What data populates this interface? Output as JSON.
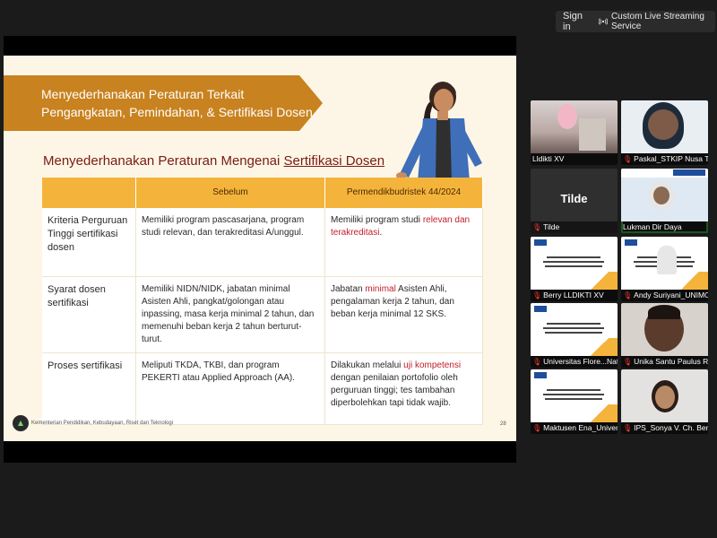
{
  "topbar": {
    "sign_in": "Sign in",
    "streaming": "Custom Live Streaming Service",
    "streaming_icon": "broadcast-icon"
  },
  "slide": {
    "banner_line1": "Menyederhanakan Peraturan Terkait",
    "banner_line2": "Pengangkatan, Pemindahan, & Sertifikasi Dosen",
    "heading_prefix": "Menyederhanakan Peraturan Mengenai ",
    "heading_underlined": "Sertifikasi Dosen",
    "table": {
      "col1": "",
      "col2": "Sebelum",
      "col3": "Permendikbudristek 44/2024",
      "rows": [
        {
          "key": "Kriteria Perguruan Tinggi sertifikasi dosen",
          "before": "Memiliki program pascasarjana, program studi relevan, dan terakreditasi A/unggul.",
          "after_pre": "Memiliki program studi ",
          "after_hl": "relevan dan terakreditasi",
          "after_post": "."
        },
        {
          "key": "Syarat dosen sertifikasi",
          "before": "Memiliki NIDN/NIDK, jabatan minimal Asisten Ahli, pangkat/golongan atau inpassing, masa kerja minimal 2 tahun, dan memenuhi beban kerja 2 tahun berturut-turut.",
          "after_pre": "Jabatan ",
          "after_hl": "minimal",
          "after_post": " Asisten Ahli, pengalaman kerja 2 tahun, dan beban kerja minimal 12 SKS."
        },
        {
          "key": "Proses sertifikasi",
          "before": "Meliputi TKDA, TKBI, dan program PEKERTI atau Applied Approach (AA).",
          "after_pre": "Dilakukan melalui ",
          "after_hl": "uji kompetensi",
          "after_post": " dengan penilaian portofolio oleh perguruan tinggi; tes tambahan diperbolehkan tapi tidak wajib."
        }
      ]
    },
    "footer": "Kementerian Pendidikan, Kebudayaan, Riset dan Teknologi",
    "page_number": "28"
  },
  "participants": [
    {
      "name": "Lldikti XV",
      "muted": false,
      "kind": "photo"
    },
    {
      "name": "Paskal_STKIP Nusa Tim...",
      "muted": true,
      "kind": "photo"
    },
    {
      "name": "Tilde",
      "muted": true,
      "kind": "avatar",
      "display": "Tilde"
    },
    {
      "name": "Lukman Dir Daya",
      "muted": false,
      "kind": "slide",
      "active": true
    },
    {
      "name": "Berry LLDIKTI XV",
      "muted": true,
      "kind": "slide"
    },
    {
      "name": "Andy Suriyani_UNIMOF",
      "muted": true,
      "kind": "slide"
    },
    {
      "name": "Universitas Flore...Nat...",
      "muted": true,
      "kind": "slide"
    },
    {
      "name": "Unika Santu Paulus Ru...",
      "muted": true,
      "kind": "slide"
    },
    {
      "name": "Maktusen Ena_Universi...",
      "muted": true,
      "kind": "slide"
    },
    {
      "name": "IPS_Sonya V. Ch. Benu",
      "muted": true,
      "kind": "photo"
    }
  ],
  "colors": {
    "banner": "#c8821f",
    "header": "#f4b43b",
    "highlight": "#c0202c",
    "active_speaker": "#39c34a"
  }
}
